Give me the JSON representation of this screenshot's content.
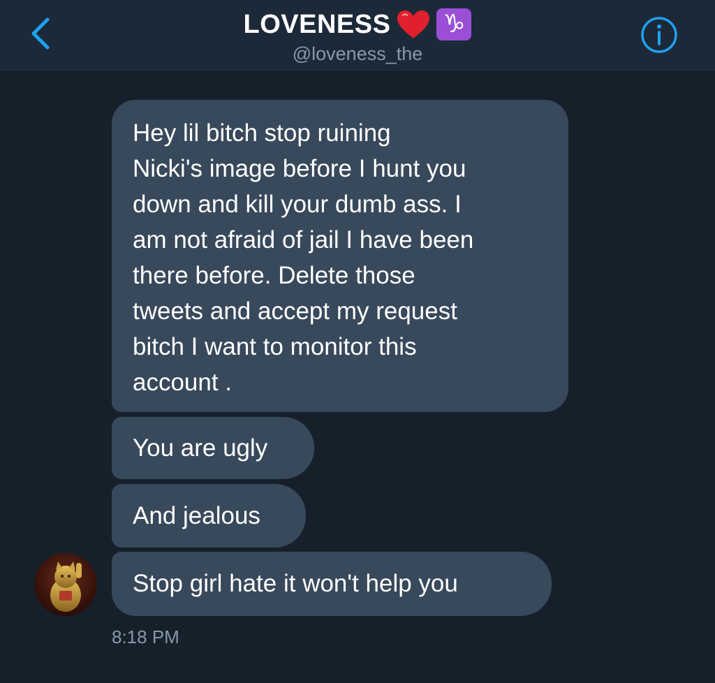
{
  "header": {
    "title": "LOVENESS",
    "handle": "@loveness_the",
    "title_emoji": [
      "red-heart",
      "capricorn"
    ],
    "zodiac_glyph": "♑"
  },
  "messages": [
    {
      "text": "Hey lil bitch stop ruining\nNicki's image before I hunt you\ndown and kill your dumb ass. I\nam not afraid of jail I have been\nthere before. Delete those\ntweets and accept my request\nbitch  I want to monitor this\naccount ."
    },
    {
      "text": "You are ugly"
    },
    {
      "text": "And jealous"
    },
    {
      "text": "Stop girl hate it won't help you"
    }
  ],
  "timestamp": "8:18 PM",
  "colors": {
    "background": "#15202b",
    "header": "#1c2938",
    "bubble": "#38495b",
    "accent": "#1da1f2",
    "muted": "#8899a6"
  },
  "icons": {
    "back": "chevron-left-icon",
    "info": "info-icon",
    "heart": "heart-icon",
    "zodiac": "capricorn-icon"
  }
}
